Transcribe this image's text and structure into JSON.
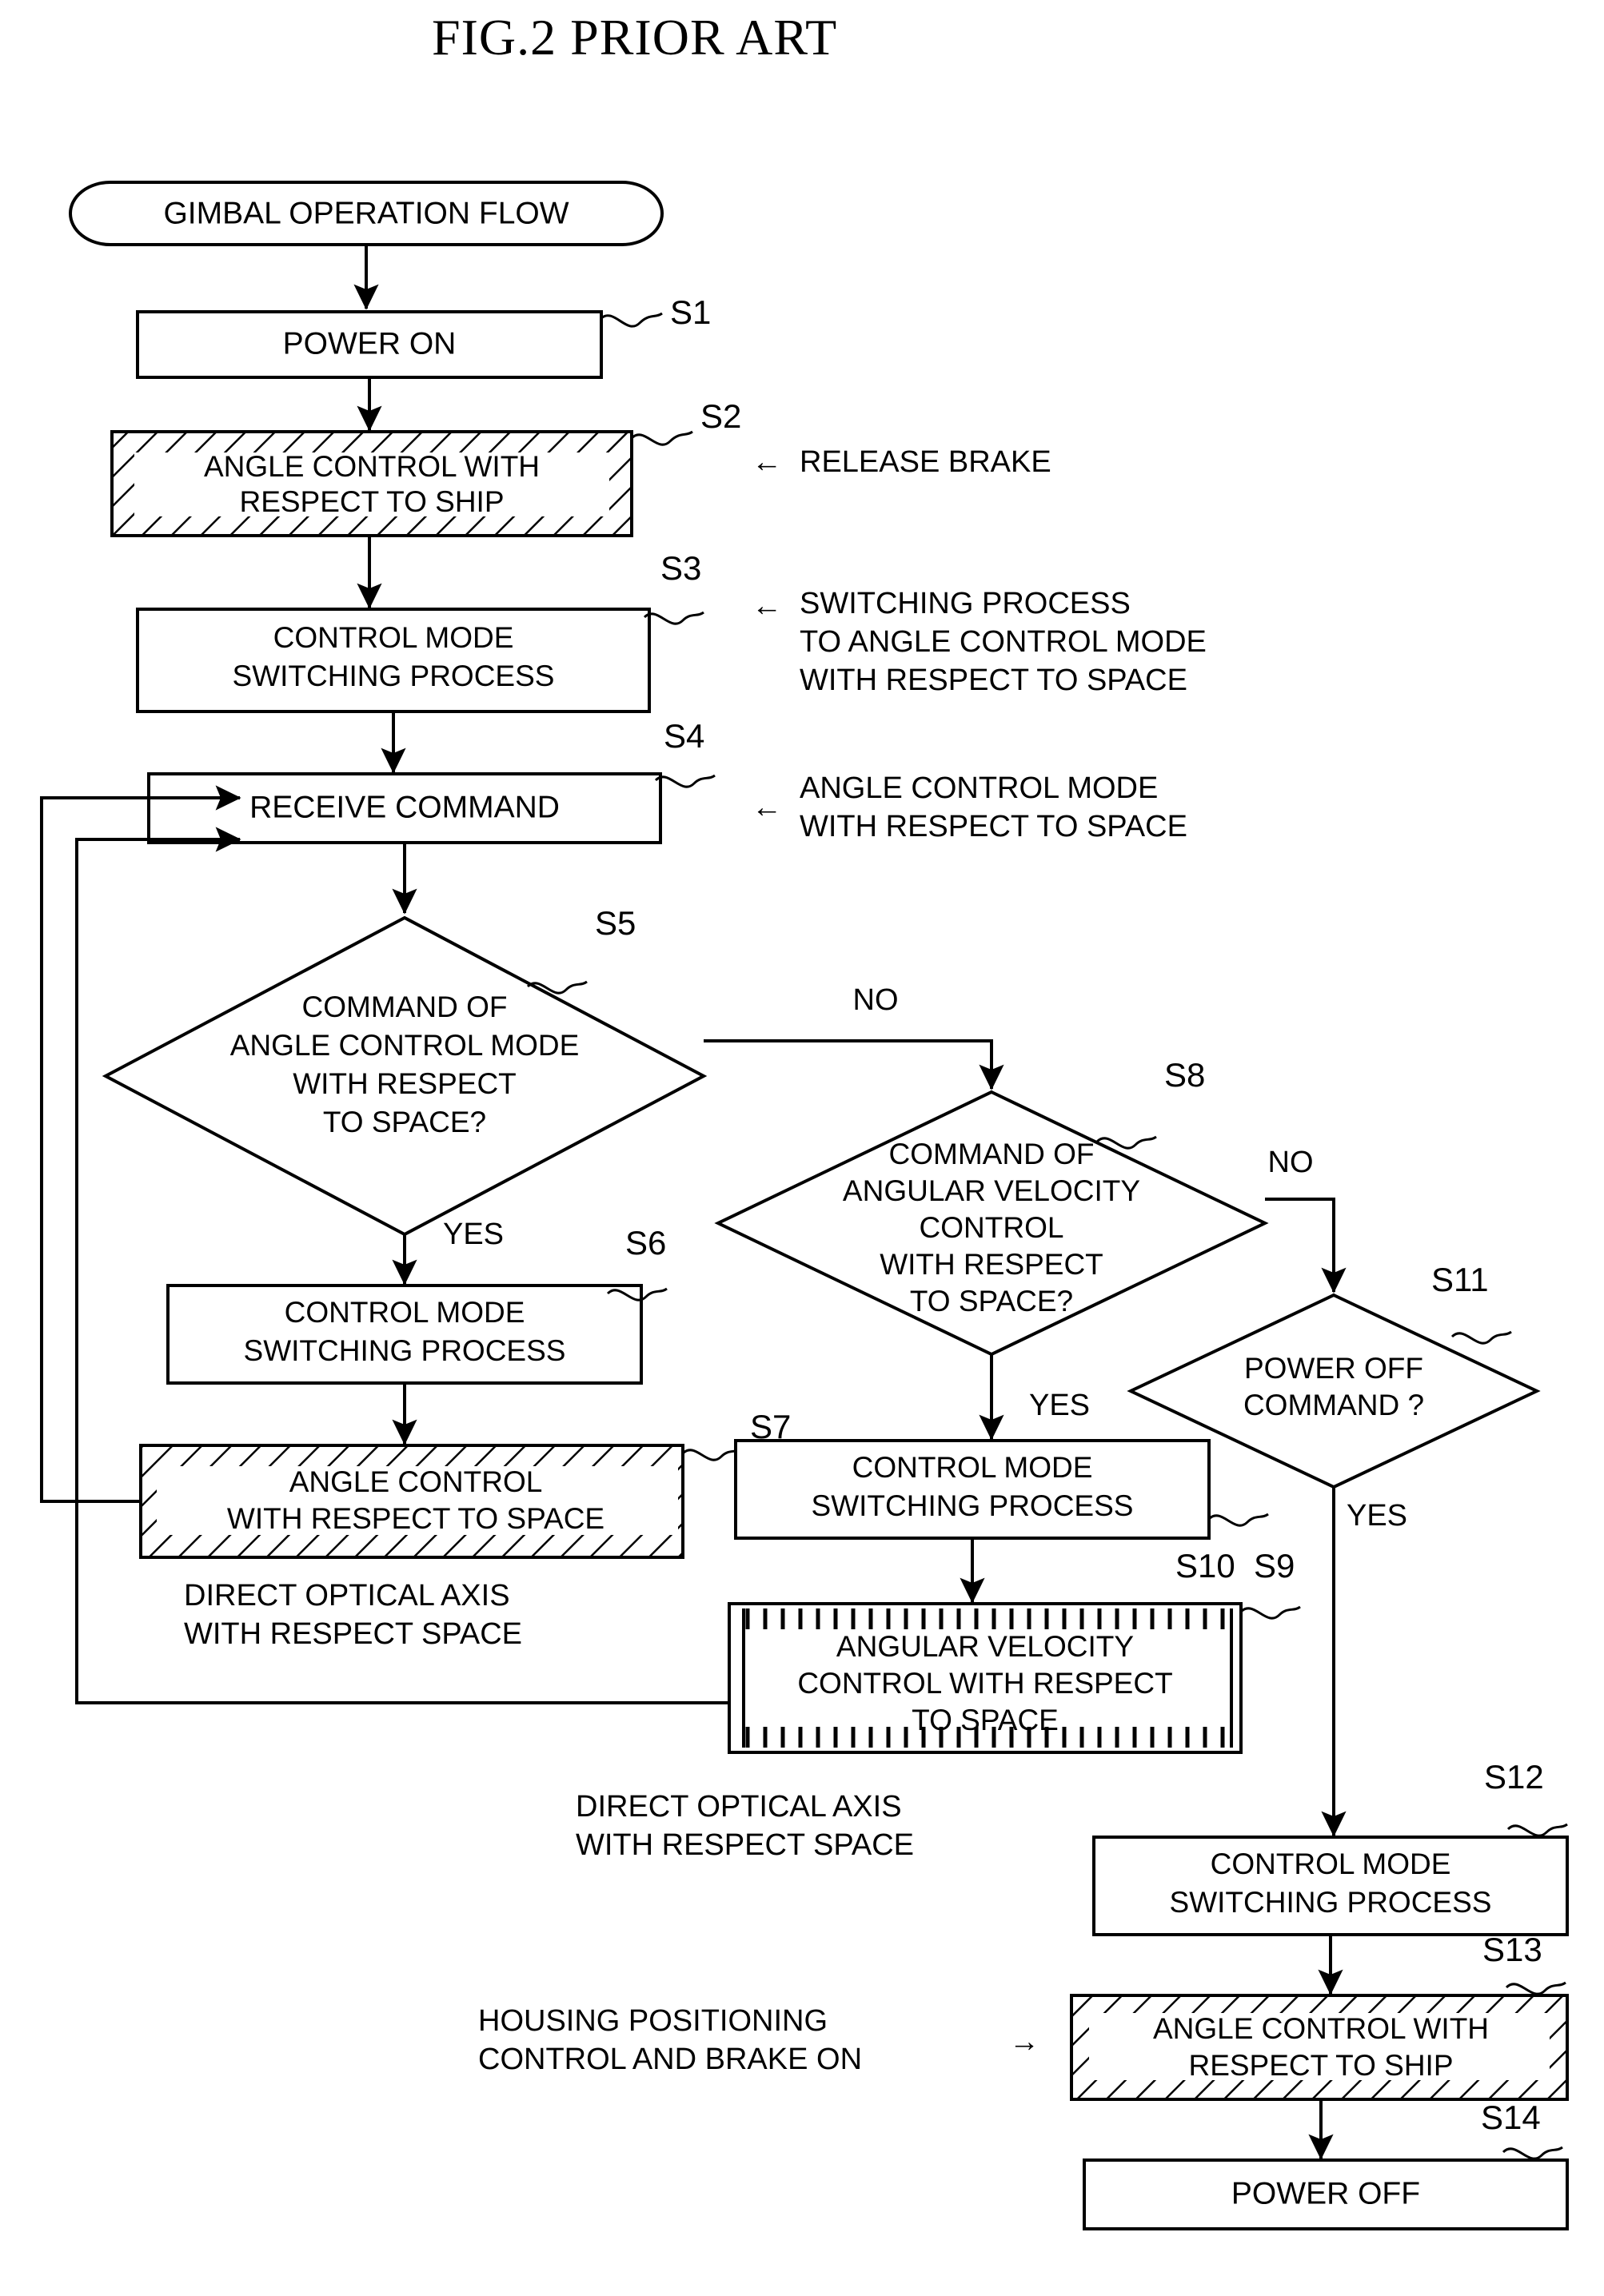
{
  "figure": {
    "title": "FIG.2  PRIOR ART",
    "start_terminal": "GIMBAL OPERATION FLOW"
  },
  "nodes": {
    "s1": {
      "ref": "S1",
      "label": "POWER ON"
    },
    "s2": {
      "ref": "S2",
      "line1": "ANGLE CONTROL WITH",
      "line2": "RESPECT TO SHIP"
    },
    "s3": {
      "ref": "S3",
      "line1": "CONTROL MODE",
      "line2": "SWITCHING PROCESS"
    },
    "s4": {
      "ref": "S4",
      "label": "RECEIVE COMMAND"
    },
    "s5": {
      "ref": "S5",
      "line1": "COMMAND OF",
      "line2": "ANGLE CONTROL MODE",
      "line3": "WITH RESPECT",
      "line4": "TO SPACE?"
    },
    "s6": {
      "ref": "S6",
      "line1": "CONTROL MODE",
      "line2": "SWITCHING PROCESS"
    },
    "s7": {
      "ref": "S7",
      "line1": "ANGLE CONTROL",
      "line2": "WITH RESPECT TO SPACE"
    },
    "s8": {
      "ref": "S8",
      "line1": "COMMAND OF",
      "line2": "ANGULAR VELOCITY",
      "line3": "CONTROL",
      "line4": "WITH RESPECT",
      "line5": "TO SPACE?"
    },
    "s9": {
      "ref": "S9",
      "line1": "CONTROL MODE",
      "line2": "SWITCHING PROCESS"
    },
    "s10": {
      "ref": "S10",
      "line1": "ANGULAR VELOCITY",
      "line2": "CONTROL WITH RESPECT",
      "line3": "TO SPACE"
    },
    "s11": {
      "ref": "S11",
      "line1": "POWER OFF",
      "line2": "COMMAND ?"
    },
    "s12": {
      "ref": "S12",
      "line1": "CONTROL MODE",
      "line2": "SWITCHING PROCESS"
    },
    "s13": {
      "ref": "S13",
      "line1": "ANGLE CONTROL WITH",
      "line2": "RESPECT TO SHIP"
    },
    "s14": {
      "ref": "S14",
      "label": "POWER OFF"
    }
  },
  "edge_labels": {
    "s5_no": "NO",
    "s5_yes": "YES",
    "s8_no": "NO",
    "s8_yes": "YES",
    "s11_yes": "YES"
  },
  "annotations": {
    "release_brake": {
      "arrow": "←",
      "line1": "RELEASE BRAKE"
    },
    "switch_to_angle_space": {
      "arrow": "←",
      "line1": "SWITCHING PROCESS",
      "line2": "TO ANGLE CONTROL MODE",
      "line3": "WITH RESPECT TO SPACE"
    },
    "angle_mode_space": {
      "arrow": "←",
      "line1": "ANGLE CONTROL MODE",
      "line2": "WITH RESPECT TO SPACE"
    },
    "direct_axis_left": {
      "line1": "DIRECT OPTICAL AXIS",
      "line2": "WITH RESPECT SPACE"
    },
    "direct_axis_mid": {
      "line1": "DIRECT OPTICAL AXIS",
      "line2": "WITH RESPECT SPACE"
    },
    "housing_positioning": {
      "arrow": "→",
      "line1": "HOUSING POSITIONING",
      "line2": "CONTROL AND BRAKE ON"
    }
  },
  "colors": {
    "ink": "#000000",
    "paper": "#ffffff"
  }
}
